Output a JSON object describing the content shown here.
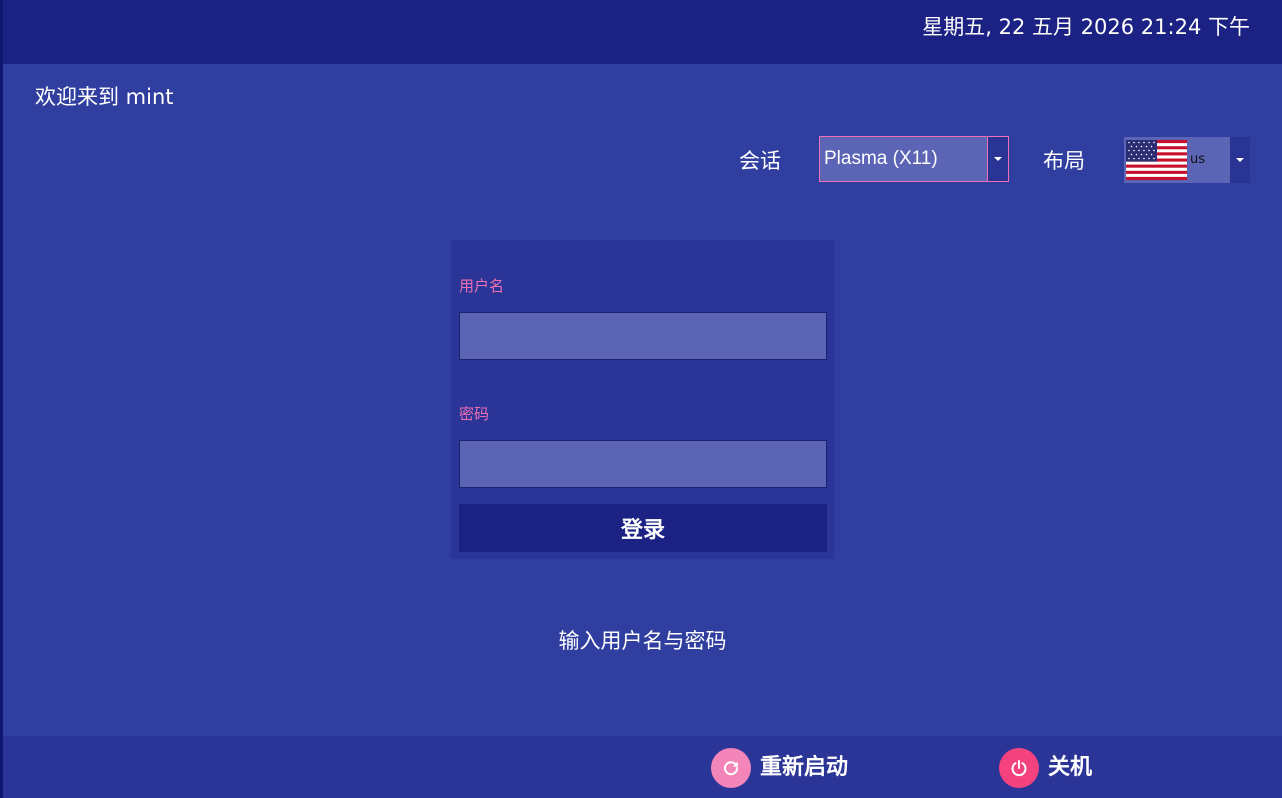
{
  "top_bar": {
    "clock": "星期五, 22 五月 2026  21:24 下午"
  },
  "welcome": "欢迎来到 mint",
  "session": {
    "label": "会话",
    "value": "Plasma (X11)"
  },
  "layout": {
    "label": "布局",
    "value": "us",
    "flag_icon": "us-flag-icon"
  },
  "login": {
    "username_label": "用户名",
    "username_value": "",
    "password_label": "密码",
    "password_value": "",
    "submit_label": "登录"
  },
  "hint": "输入用户名与密码",
  "power": {
    "restart_label": "重新启动",
    "restart_icon": "restart-icon",
    "shutdown_label": "关机",
    "shutdown_icon": "power-icon"
  },
  "colors": {
    "background": "#303ea0",
    "top_bar": "#1b2283",
    "panel": "#2b3597",
    "input_fill": "#5b64b5",
    "accent_pink": "#ef6fb4",
    "restart_icon_bg": "#f385b8",
    "shutdown_icon_bg": "#f4427e"
  }
}
